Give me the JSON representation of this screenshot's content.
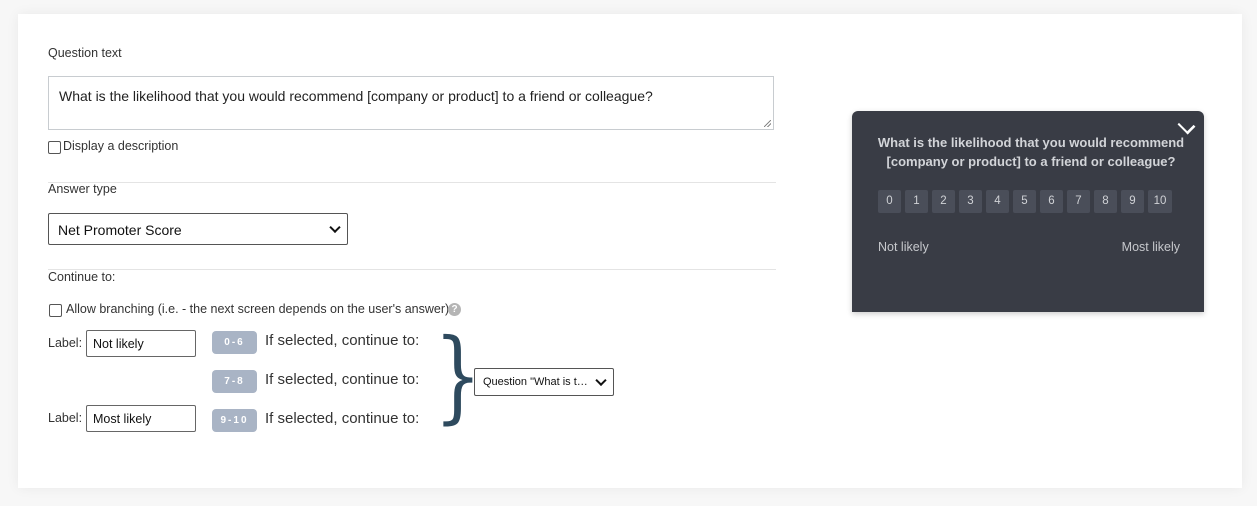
{
  "question": {
    "label": "Question text",
    "value": "What is the likelihood that you would recommend [company or product] to a friend or colleague?",
    "description_checkbox_label": "Display a description",
    "description_checked": false
  },
  "answer_type": {
    "label": "Answer type",
    "selected": "Net Promoter Score"
  },
  "continue_to": {
    "label": "Continue to:",
    "branching_label": "Allow branching (i.e. - the next screen depends on the user's answer)",
    "branching_checked": false,
    "help_icon": "?",
    "label_prefix": "Label:",
    "ranges": [
      {
        "range": "0-6",
        "label_value": "Not likely",
        "text": "If selected, continue to:"
      },
      {
        "range": "7-8",
        "label_value": null,
        "text": "If selected, continue to:"
      },
      {
        "range": "9-10",
        "label_value": "Most likely",
        "text": "If selected, continue to:"
      }
    ],
    "destination_selected": "Question \"What is t…"
  },
  "preview": {
    "question": "What is the likelihood that you would recommend [company or product] to a friend or colleague?",
    "scale": [
      "0",
      "1",
      "2",
      "3",
      "4",
      "5",
      "6",
      "7",
      "8",
      "9",
      "10"
    ],
    "low_label": "Not likely",
    "high_label": "Most likely",
    "background_color": "#393c45"
  },
  "icons": {
    "collapse": "chevron-down-icon",
    "help": "question-circle-icon",
    "brace": "right-curly-brace"
  }
}
